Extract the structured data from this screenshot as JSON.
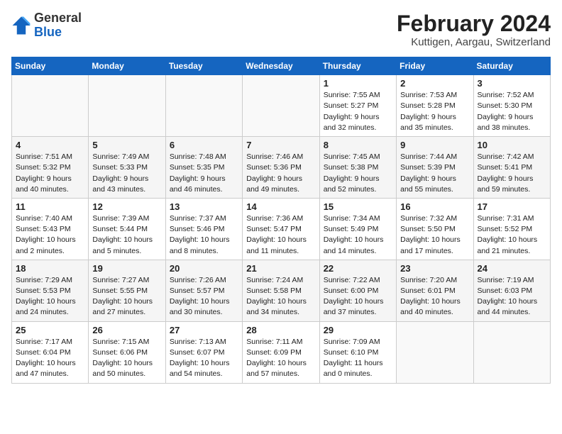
{
  "header": {
    "logo": {
      "general": "General",
      "blue": "Blue"
    },
    "title": "February 2024",
    "location": "Kuttigen, Aargau, Switzerland"
  },
  "days_of_week": [
    "Sunday",
    "Monday",
    "Tuesday",
    "Wednesday",
    "Thursday",
    "Friday",
    "Saturday"
  ],
  "weeks": [
    [
      {
        "num": "",
        "info": ""
      },
      {
        "num": "",
        "info": ""
      },
      {
        "num": "",
        "info": ""
      },
      {
        "num": "",
        "info": ""
      },
      {
        "num": "1",
        "info": "Sunrise: 7:55 AM\nSunset: 5:27 PM\nDaylight: 9 hours\nand 32 minutes."
      },
      {
        "num": "2",
        "info": "Sunrise: 7:53 AM\nSunset: 5:28 PM\nDaylight: 9 hours\nand 35 minutes."
      },
      {
        "num": "3",
        "info": "Sunrise: 7:52 AM\nSunset: 5:30 PM\nDaylight: 9 hours\nand 38 minutes."
      }
    ],
    [
      {
        "num": "4",
        "info": "Sunrise: 7:51 AM\nSunset: 5:32 PM\nDaylight: 9 hours\nand 40 minutes."
      },
      {
        "num": "5",
        "info": "Sunrise: 7:49 AM\nSunset: 5:33 PM\nDaylight: 9 hours\nand 43 minutes."
      },
      {
        "num": "6",
        "info": "Sunrise: 7:48 AM\nSunset: 5:35 PM\nDaylight: 9 hours\nand 46 minutes."
      },
      {
        "num": "7",
        "info": "Sunrise: 7:46 AM\nSunset: 5:36 PM\nDaylight: 9 hours\nand 49 minutes."
      },
      {
        "num": "8",
        "info": "Sunrise: 7:45 AM\nSunset: 5:38 PM\nDaylight: 9 hours\nand 52 minutes."
      },
      {
        "num": "9",
        "info": "Sunrise: 7:44 AM\nSunset: 5:39 PM\nDaylight: 9 hours\nand 55 minutes."
      },
      {
        "num": "10",
        "info": "Sunrise: 7:42 AM\nSunset: 5:41 PM\nDaylight: 9 hours\nand 59 minutes."
      }
    ],
    [
      {
        "num": "11",
        "info": "Sunrise: 7:40 AM\nSunset: 5:43 PM\nDaylight: 10 hours\nand 2 minutes."
      },
      {
        "num": "12",
        "info": "Sunrise: 7:39 AM\nSunset: 5:44 PM\nDaylight: 10 hours\nand 5 minutes."
      },
      {
        "num": "13",
        "info": "Sunrise: 7:37 AM\nSunset: 5:46 PM\nDaylight: 10 hours\nand 8 minutes."
      },
      {
        "num": "14",
        "info": "Sunrise: 7:36 AM\nSunset: 5:47 PM\nDaylight: 10 hours\nand 11 minutes."
      },
      {
        "num": "15",
        "info": "Sunrise: 7:34 AM\nSunset: 5:49 PM\nDaylight: 10 hours\nand 14 minutes."
      },
      {
        "num": "16",
        "info": "Sunrise: 7:32 AM\nSunset: 5:50 PM\nDaylight: 10 hours\nand 17 minutes."
      },
      {
        "num": "17",
        "info": "Sunrise: 7:31 AM\nSunset: 5:52 PM\nDaylight: 10 hours\nand 21 minutes."
      }
    ],
    [
      {
        "num": "18",
        "info": "Sunrise: 7:29 AM\nSunset: 5:53 PM\nDaylight: 10 hours\nand 24 minutes."
      },
      {
        "num": "19",
        "info": "Sunrise: 7:27 AM\nSunset: 5:55 PM\nDaylight: 10 hours\nand 27 minutes."
      },
      {
        "num": "20",
        "info": "Sunrise: 7:26 AM\nSunset: 5:57 PM\nDaylight: 10 hours\nand 30 minutes."
      },
      {
        "num": "21",
        "info": "Sunrise: 7:24 AM\nSunset: 5:58 PM\nDaylight: 10 hours\nand 34 minutes."
      },
      {
        "num": "22",
        "info": "Sunrise: 7:22 AM\nSunset: 6:00 PM\nDaylight: 10 hours\nand 37 minutes."
      },
      {
        "num": "23",
        "info": "Sunrise: 7:20 AM\nSunset: 6:01 PM\nDaylight: 10 hours\nand 40 minutes."
      },
      {
        "num": "24",
        "info": "Sunrise: 7:19 AM\nSunset: 6:03 PM\nDaylight: 10 hours\nand 44 minutes."
      }
    ],
    [
      {
        "num": "25",
        "info": "Sunrise: 7:17 AM\nSunset: 6:04 PM\nDaylight: 10 hours\nand 47 minutes."
      },
      {
        "num": "26",
        "info": "Sunrise: 7:15 AM\nSunset: 6:06 PM\nDaylight: 10 hours\nand 50 minutes."
      },
      {
        "num": "27",
        "info": "Sunrise: 7:13 AM\nSunset: 6:07 PM\nDaylight: 10 hours\nand 54 minutes."
      },
      {
        "num": "28",
        "info": "Sunrise: 7:11 AM\nSunset: 6:09 PM\nDaylight: 10 hours\nand 57 minutes."
      },
      {
        "num": "29",
        "info": "Sunrise: 7:09 AM\nSunset: 6:10 PM\nDaylight: 11 hours\nand 0 minutes."
      },
      {
        "num": "",
        "info": ""
      },
      {
        "num": "",
        "info": ""
      }
    ]
  ]
}
